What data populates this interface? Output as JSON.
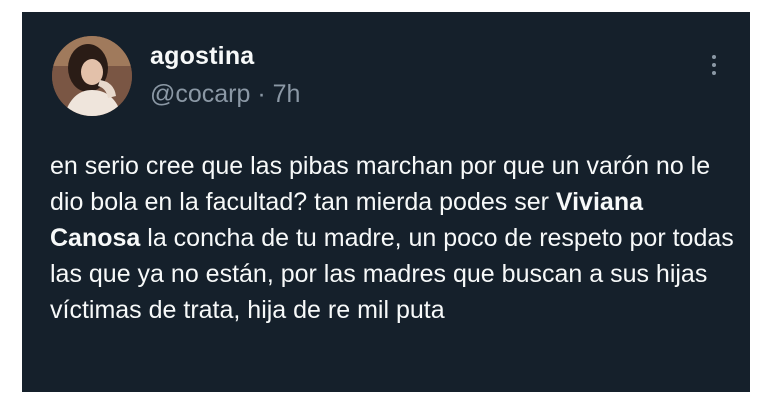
{
  "tweet": {
    "author": {
      "display_name": "agostina",
      "handle": "@cocarp",
      "separator": "·",
      "time_ago": "7h"
    },
    "more_icon": "more-vertical-icon",
    "body": {
      "part1": "en serio cree que las pibas marchan por que un varón no le dio bola en la facultad? tan mierda podes ser ",
      "mention": "Viviana Canosa",
      "part2": " la concha de tu madre, un poco de respeto por todas las que ya no están, por las madres que buscan a sus hijas víctimas de trata, hija de re mil puta"
    }
  },
  "colors": {
    "background": "#15202b",
    "text": "#f7f9f9",
    "muted": "#8b98a5"
  }
}
